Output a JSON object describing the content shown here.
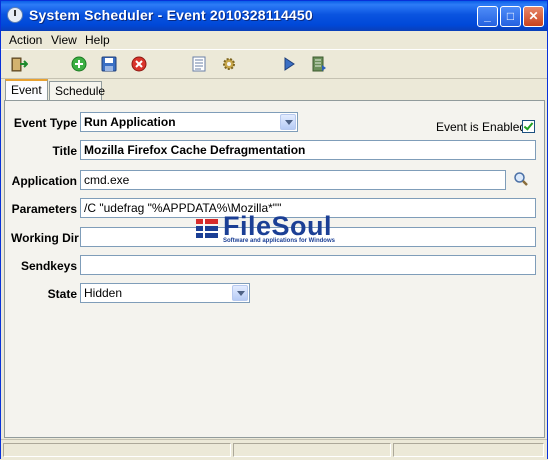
{
  "window": {
    "title": "System Scheduler - Event 2010328114450",
    "min_label": "_",
    "max_label": "□",
    "close_label": "✕"
  },
  "menu": {
    "items": [
      {
        "label": "Action"
      },
      {
        "label": "View"
      },
      {
        "label": "Help"
      }
    ]
  },
  "toolbar": {
    "buttons": [
      {
        "icon": "exit-icon"
      },
      {
        "icon": "add-icon"
      },
      {
        "icon": "save-icon"
      },
      {
        "icon": "delete-icon"
      },
      {
        "icon": "list-icon"
      },
      {
        "icon": "settings-icon"
      },
      {
        "icon": "run-icon"
      },
      {
        "icon": "export-icon"
      }
    ]
  },
  "tabs": [
    {
      "label": "Event",
      "active": true
    },
    {
      "label": "Schedule",
      "active": false
    }
  ],
  "form": {
    "event_type_label": "Event Type",
    "event_type_value": "Run Application",
    "enabled_label": "Event is Enabled",
    "enabled_checked": true,
    "title_label": "Title",
    "title_value": "Mozilla Firefox Cache Defragmentation",
    "application_label": "Application",
    "application_value": "cmd.exe",
    "parameters_label": "Parameters",
    "parameters_value": "/C \"udefrag \"%APPDATA%\\Mozilla*\"\"",
    "working_dir_label": "Working Dir",
    "working_dir_value": "",
    "sendkeys_label": "Sendkeys",
    "sendkeys_value": "",
    "state_label": "State",
    "state_value": "Hidden"
  },
  "watermark": {
    "text": "FileSoul",
    "subtext": "Software and applications for Windows"
  },
  "colors": {
    "titlebar": "#0a54e0",
    "window_bg": "#ece9d8",
    "panel_bg": "#f4f3ee",
    "field_border": "#7f9db9",
    "active_tab_accent": "#e8a232"
  }
}
